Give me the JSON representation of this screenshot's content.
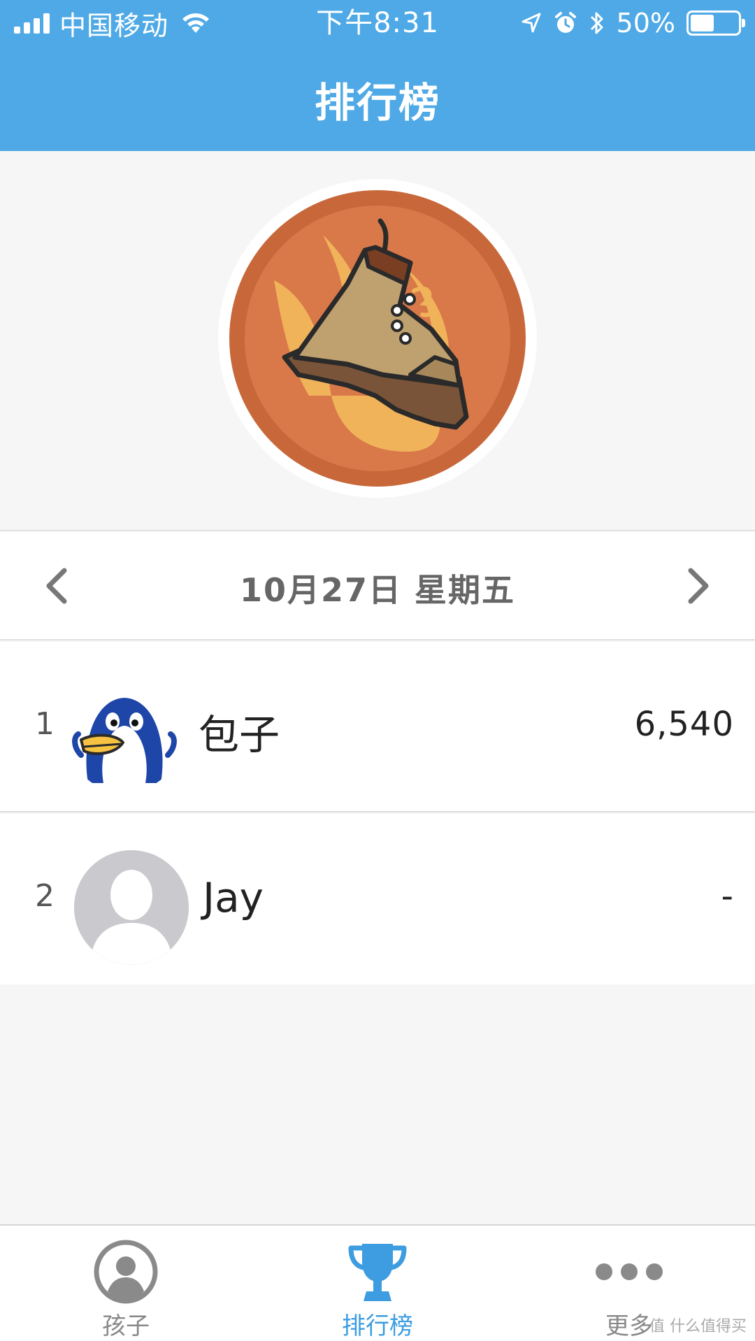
{
  "status_bar": {
    "carrier": "中国移动",
    "time": "下午8:31",
    "battery": "50%",
    "battery_level": 0.5
  },
  "header": {
    "title": "排行榜"
  },
  "badge": {
    "icon": "flaming-boot-badge"
  },
  "date_nav": {
    "date": "10月27日 星期五"
  },
  "leaderboard": [
    {
      "rank": "1",
      "name": "包子",
      "score": "6,540",
      "avatar": "penguin-avatar"
    },
    {
      "rank": "2",
      "name": "Jay",
      "score": "-",
      "avatar": "default-avatar"
    }
  ],
  "tabs": [
    {
      "label": "孩子",
      "icon": "person-icon",
      "active": false
    },
    {
      "label": "排行榜",
      "icon": "trophy-icon",
      "active": true
    },
    {
      "label": "更多",
      "icon": "more-icon",
      "active": false
    }
  ],
  "colors": {
    "header": "#4ea9e6",
    "active_tab": "#3d9de0",
    "inactive_tab": "#888888",
    "badge_outer": "#c8683a",
    "badge_inner": "#d9794a"
  },
  "watermark": "值 什么值得买"
}
